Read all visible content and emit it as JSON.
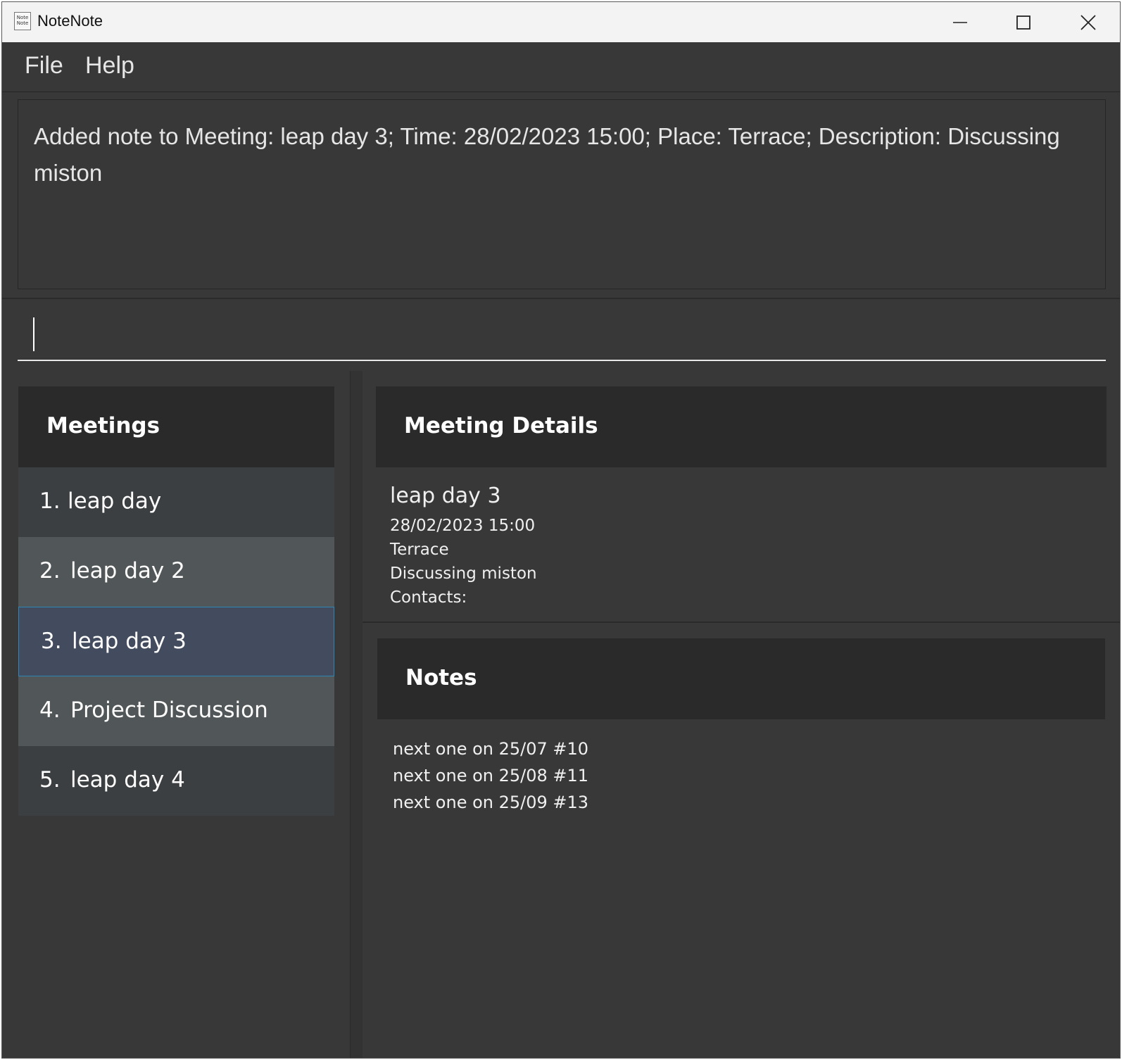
{
  "window": {
    "title": "NoteNote",
    "app_icon_text": "Note Note"
  },
  "menu": {
    "items": [
      {
        "label": "File"
      },
      {
        "label": "Help"
      }
    ]
  },
  "result": {
    "text": "Added note to Meeting: leap day 3; Time: 28/02/2023 15:00; Place: Terrace; Description: Discussing miston"
  },
  "command": {
    "value": "",
    "placeholder": ""
  },
  "meetings": {
    "header": "Meetings",
    "items": [
      {
        "index": "1.",
        "name": "leap day"
      },
      {
        "index": "2.",
        "name": "leap day 2"
      },
      {
        "index": "3.",
        "name": "leap day 3",
        "selected": true
      },
      {
        "index": "4.",
        "name": "Project Discussion"
      },
      {
        "index": "5.",
        "name": "leap day 4"
      }
    ]
  },
  "details": {
    "header": "Meeting Details",
    "title": "leap day 3",
    "time": "28/02/2023 15:00",
    "place": "Terrace",
    "description": "Discussing miston",
    "contacts": "Contacts:"
  },
  "notes": {
    "header": "Notes",
    "items": [
      "next one on 25/07 #10",
      "next one on 25/08 #11",
      "next one on 25/09 #13"
    ]
  },
  "colors": {
    "background": "#383838",
    "header": "#2a2a2a",
    "list_odd": "#3c3f41",
    "list_even": "#515658",
    "list_selected": "#424c5e",
    "selection_border": "#2e86b5"
  },
  "icons": {
    "minimize": "minimize-icon",
    "maximize": "maximize-icon",
    "close": "close-icon",
    "app": "app-icon"
  }
}
